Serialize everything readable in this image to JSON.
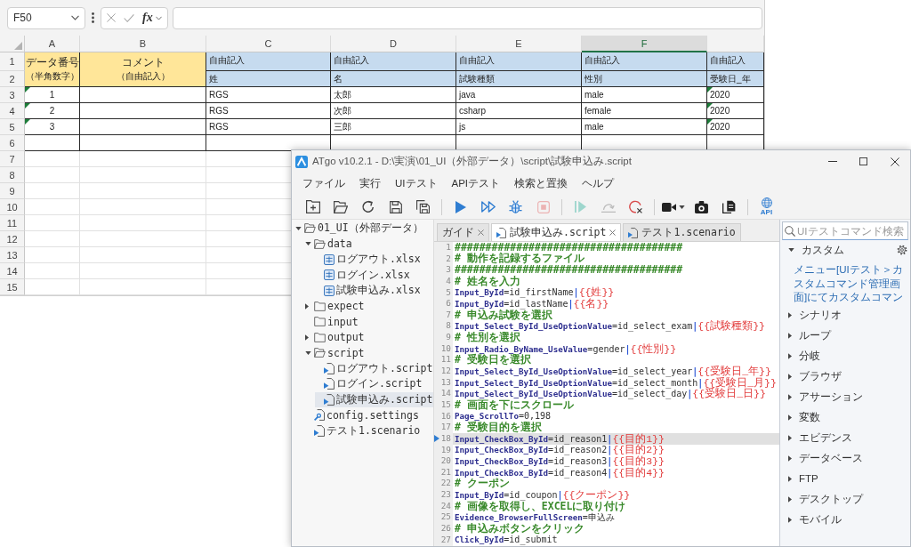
{
  "spreadsheet": {
    "name_box": "F50",
    "function_label": "fx",
    "columns": [
      {
        "label": "A",
        "selected": false
      },
      {
        "label": "B",
        "selected": false
      },
      {
        "label": "C",
        "selected": false
      },
      {
        "label": "D",
        "selected": false
      },
      {
        "label": "E",
        "selected": false
      },
      {
        "label": "F",
        "selected": true
      }
    ],
    "row_numbers": [
      "1",
      "2",
      "3",
      "4",
      "5",
      "6",
      "7",
      "8",
      "9",
      "10",
      "11",
      "12",
      "13",
      "14",
      "15"
    ],
    "header": [
      {
        "kind": "fixed",
        "lines": [
          "データ番号",
          "（半角数字）"
        ]
      },
      {
        "kind": "fixed",
        "lines": [
          "コメント",
          "（自由記入）"
        ]
      },
      {
        "kind": "free",
        "group": "自由記入",
        "field": "姓"
      },
      {
        "kind": "free",
        "group": "自由記入",
        "field": "名"
      },
      {
        "kind": "free",
        "group": "自由記入",
        "field": "試験種類"
      },
      {
        "kind": "free",
        "group": "自由記入",
        "field": "性別"
      },
      {
        "kind": "free",
        "group": "自由記入",
        "field": "受験日_年"
      }
    ],
    "records": [
      {
        "cells": [
          {
            "text": "1",
            "flagged": true
          },
          {
            "flagged": false
          },
          {
            "text": "RGS",
            "flagged": false
          },
          {
            "text": "太郎",
            "flagged": false
          },
          {
            "text": "java",
            "flagged": false
          },
          {
            "text": "male",
            "flagged": false
          },
          {
            "text": "2020",
            "flagged": true
          }
        ]
      },
      {
        "cells": [
          {
            "text": "2",
            "flagged": true
          },
          {
            "flagged": false
          },
          {
            "text": "RGS",
            "flagged": false
          },
          {
            "text": "次郎",
            "flagged": false
          },
          {
            "text": "csharp",
            "flagged": false
          },
          {
            "text": "female",
            "flagged": false
          },
          {
            "text": "2020",
            "flagged": true
          }
        ]
      },
      {
        "cells": [
          {
            "text": "3",
            "flagged": true
          },
          {
            "flagged": false
          },
          {
            "text": "RGS",
            "flagged": false
          },
          {
            "text": "三郎",
            "flagged": false
          },
          {
            "text": "js",
            "flagged": false
          },
          {
            "text": "male",
            "flagged": false
          },
          {
            "text": "2020",
            "flagged": true
          }
        ]
      }
    ]
  },
  "atgo": {
    "title": "ATgo v10.2.1 - D:\\実演\\01_UI（外部データ）\\script\\試験申込み.script",
    "menu": [
      "ファイル",
      "実行",
      "UIテスト",
      "APIテスト",
      "検索と置換",
      "ヘルプ"
    ],
    "toolbar": [
      {
        "items": [
          {
            "kind": "new-folder",
            "disabled": false
          },
          {
            "kind": "open-folder",
            "disabled": false
          },
          {
            "kind": "reload",
            "disabled": false
          },
          {
            "kind": "save",
            "disabled": false
          },
          {
            "kind": "save-all",
            "disabled": false
          }
        ]
      },
      {
        "items": [
          {
            "kind": "run",
            "disabled": false
          },
          {
            "kind": "run-from",
            "disabled": false
          },
          {
            "kind": "debug",
            "disabled": false
          },
          {
            "kind": "stop",
            "disabled": true
          }
        ]
      },
      {
        "items": [
          {
            "kind": "resume",
            "disabled": true
          },
          {
            "kind": "step",
            "disabled": true
          },
          {
            "kind": "clear",
            "disabled": false
          }
        ]
      },
      {
        "items": [
          {
            "kind": "video",
            "disabled": false
          },
          {
            "kind": "capture",
            "disabled": false
          },
          {
            "kind": "copy",
            "disabled": false
          }
        ]
      },
      {
        "items": [
          {
            "kind": "api",
            "label": "API",
            "disabled": false
          }
        ]
      }
    ],
    "tree": [
      {
        "label": "01_UI（外部データ）",
        "kind": "folder",
        "expandable": true,
        "expanded": true,
        "selected": false,
        "children": [
          {
            "label": "data",
            "kind": "folder",
            "expandable": true,
            "expanded": true,
            "selected": false,
            "children": [
              {
                "label": "ログアウト.xlsx",
                "kind": "xlsx",
                "selected": false
              },
              {
                "label": "ログイン.xlsx",
                "kind": "xlsx",
                "selected": false
              },
              {
                "label": "試験申込み.xlsx",
                "kind": "xlsx",
                "selected": false
              }
            ]
          },
          {
            "label": "expect",
            "kind": "folder",
            "expandable": true,
            "expanded": false,
            "selected": false
          },
          {
            "label": "input",
            "kind": "folder",
            "expandable": false,
            "expanded": false,
            "selected": false
          },
          {
            "label": "output",
            "kind": "folder",
            "expandable": true,
            "expanded": false,
            "selected": false
          },
          {
            "label": "script",
            "kind": "folder",
            "expandable": true,
            "expanded": true,
            "selected": false,
            "children": [
              {
                "label": "ログアウト.script",
                "kind": "script",
                "selected": false
              },
              {
                "label": "ログイン.script",
                "kind": "script",
                "selected": false
              },
              {
                "label": "試験申込み.script",
                "kind": "script",
                "selected": true
              }
            ]
          },
          {
            "label": "config.settings",
            "kind": "settings",
            "selected": false
          },
          {
            "label": "テスト1.scenario",
            "kind": "scenario",
            "selected": false
          }
        ]
      }
    ],
    "editor": {
      "tabs": [
        {
          "label": "ガイド",
          "kind": "guide",
          "selected": false,
          "closable": true
        },
        {
          "label": "試験申込み.script",
          "kind": "script",
          "selected": true,
          "closable": true
        },
        {
          "label": "テスト1.scenario",
          "kind": "scenario",
          "selected": false,
          "closable": false
        }
      ],
      "lines": [
        {
          "number": "1",
          "comment": "#####################################",
          "current": false
        },
        {
          "number": "2",
          "comment": "# 動作を記録するファイル",
          "current": false
        },
        {
          "number": "3",
          "comment": "#####################################",
          "current": false
        },
        {
          "number": "4",
          "comment": "# 姓名を入力",
          "current": false
        },
        {
          "number": "5",
          "command": "Input_ById",
          "args": "=id_firstName",
          "pipe": "|",
          "variable": "{{姓}}",
          "current": false
        },
        {
          "number": "6",
          "command": "Input_ById",
          "args": "=id_lastName",
          "pipe": "|",
          "variable": "{{名}}",
          "current": false
        },
        {
          "number": "7",
          "comment": "# 申込み試験を選択",
          "current": false
        },
        {
          "number": "8",
          "command": "Input_Select_ById_UseOptionValue",
          "args": "=id_select_exam",
          "pipe": "|",
          "variable": "{{試験種類}}",
          "current": false
        },
        {
          "number": "9",
          "comment": "# 性別を選択",
          "current": false
        },
        {
          "number": "10",
          "command": "Input_Radio_ByName_UseValue",
          "args": "=gender",
          "pipe": "|",
          "variable": "{{性別}}",
          "current": false
        },
        {
          "number": "11",
          "comment": "# 受験日を選択",
          "current": false
        },
        {
          "number": "12",
          "command": "Input_Select_ById_UseOptionValue",
          "args": "=id_select_year",
          "pipe": "|",
          "variable": "{{受験日_年}}",
          "current": false
        },
        {
          "number": "13",
          "command": "Input_Select_ById_UseOptionValue",
          "args": "=id_select_month",
          "pipe": "|",
          "variable": "{{受験日_月}}",
          "current": false
        },
        {
          "number": "14",
          "command": "Input_Select_ById_UseOptionValue",
          "args": "=id_select_day",
          "pipe": "|",
          "variable": "{{受験日_日}}",
          "current": false
        },
        {
          "number": "15",
          "comment": "# 画面を下にスクロール",
          "current": false
        },
        {
          "number": "16",
          "command": "Page_ScrollTo",
          "args": "=0,198",
          "current": false
        },
        {
          "number": "17",
          "comment": "# 受験目的を選択",
          "current": false
        },
        {
          "number": "18",
          "command": "Input_CheckBox_ById",
          "args": "=id_reason1",
          "pipe": "|",
          "variable": "{{目的1}}",
          "current": true
        },
        {
          "number": "19",
          "command": "Input_CheckBox_ById",
          "args": "=id_reason2",
          "pipe": "|",
          "variable": "{{目的2}}",
          "current": false
        },
        {
          "number": "20",
          "command": "Input_CheckBox_ById",
          "args": "=id_reason3",
          "pipe": "|",
          "variable": "{{目的3}}",
          "current": false
        },
        {
          "number": "21",
          "command": "Input_CheckBox_ById",
          "args": "=id_reason4",
          "pipe": "|",
          "variable": "{{目的4}}",
          "current": false
        },
        {
          "number": "22",
          "comment": "# クーポン",
          "current": false
        },
        {
          "number": "23",
          "command": "Input_ById",
          "args": "=id_coupon",
          "pipe": "|",
          "variable": "{{クーポン}}",
          "current": false
        },
        {
          "number": "24",
          "comment": "# 画像を取得し、EXCELに取り付け",
          "current": false
        },
        {
          "number": "25",
          "command": "Evidence_BrowserFullScreen",
          "args": "=申込み",
          "current": false
        },
        {
          "number": "26",
          "comment": "# 申込みボタンをクリック",
          "current": false
        },
        {
          "number": "27",
          "command": "Click_ById",
          "args": "=id_submit",
          "current": false
        }
      ]
    },
    "commands": {
      "search": {
        "placeholder": "UIテストコマンド検索"
      },
      "categories": [
        {
          "label": "カスタム",
          "kind": "custom",
          "expanded": true,
          "description": "メニュー[UIテスト＞カスタムコマンド管理画面]にてカスタムコマン"
        },
        {
          "label": "シナリオ",
          "kind": "builtin",
          "expanded": false
        },
        {
          "label": "ループ",
          "kind": "builtin",
          "expanded": false
        },
        {
          "label": "分岐",
          "kind": "builtin",
          "expanded": false
        },
        {
          "label": "ブラウザ",
          "kind": "builtin",
          "expanded": false
        },
        {
          "label": "アサーション",
          "kind": "builtin",
          "expanded": false
        },
        {
          "label": "変数",
          "kind": "builtin",
          "expanded": false
        },
        {
          "label": "エビデンス",
          "kind": "builtin",
          "expanded": false
        },
        {
          "label": "データベース",
          "kind": "builtin",
          "expanded": false
        },
        {
          "label": "FTP",
          "kind": "builtin",
          "expanded": false
        },
        {
          "label": "デスクトップ",
          "kind": "builtin",
          "expanded": false
        },
        {
          "label": "モバイル",
          "kind": "builtin",
          "expanded": false
        }
      ]
    }
  }
}
